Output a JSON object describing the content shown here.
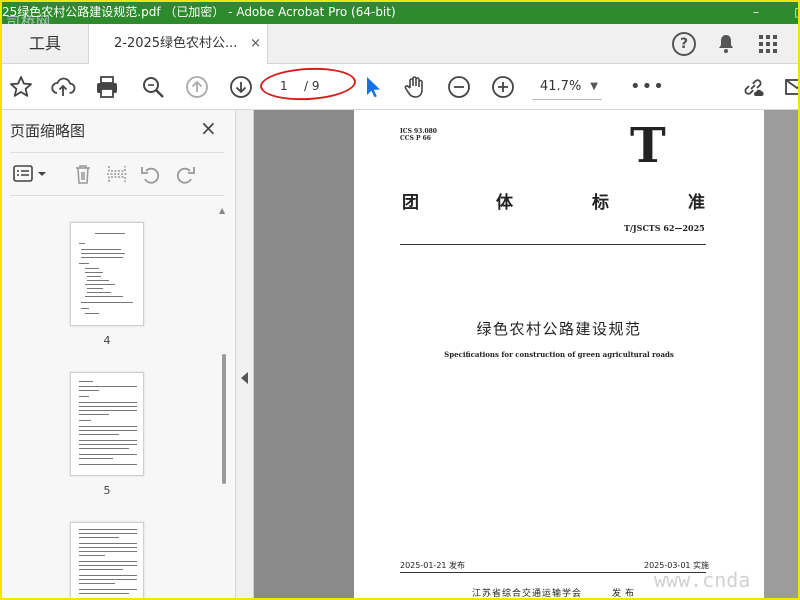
{
  "window": {
    "title": "25绿色农村公路建设规范.pdf （已加密） - Adobe Acrobat Pro (64-bit)",
    "minimize": "–",
    "maximize": "□"
  },
  "watermark_top": "司桥网",
  "tabs": {
    "tools": "工具",
    "document": "2-2025绿色农村公...",
    "close": "×"
  },
  "header_icons": {
    "help": "?",
    "help_icon": "help-icon",
    "bell_icon": "bell-icon",
    "apps_icon": "apps-grid-icon"
  },
  "toolbar": {
    "page_current": "1",
    "page_total": "/ 9",
    "zoom": "41.7%",
    "zoom_caret": "▼",
    "more": "•••"
  },
  "sidebar": {
    "title": "页面缩略图",
    "close": "×",
    "thumbnails": [
      {
        "label": "4"
      },
      {
        "label": "5"
      },
      {
        "label": ""
      }
    ]
  },
  "document": {
    "ics": "ICS 93.080",
    "ccs": "CCS P 66",
    "letter": "T",
    "standard_chars": [
      "团",
      "体",
      "标",
      "准"
    ],
    "standard_number": "T/JSCTS 62—2025",
    "title_cn": "绿色农村公路建设规范",
    "title_en": "Specifications for construction of green agricultural roads",
    "publish_date": "2025-01-21 发布",
    "implement_date": "2025-03-01 实施",
    "publisher": "江苏省综合交通运输学会",
    "publish_word": "发布"
  },
  "watermark_bottom": "www.cnda"
}
